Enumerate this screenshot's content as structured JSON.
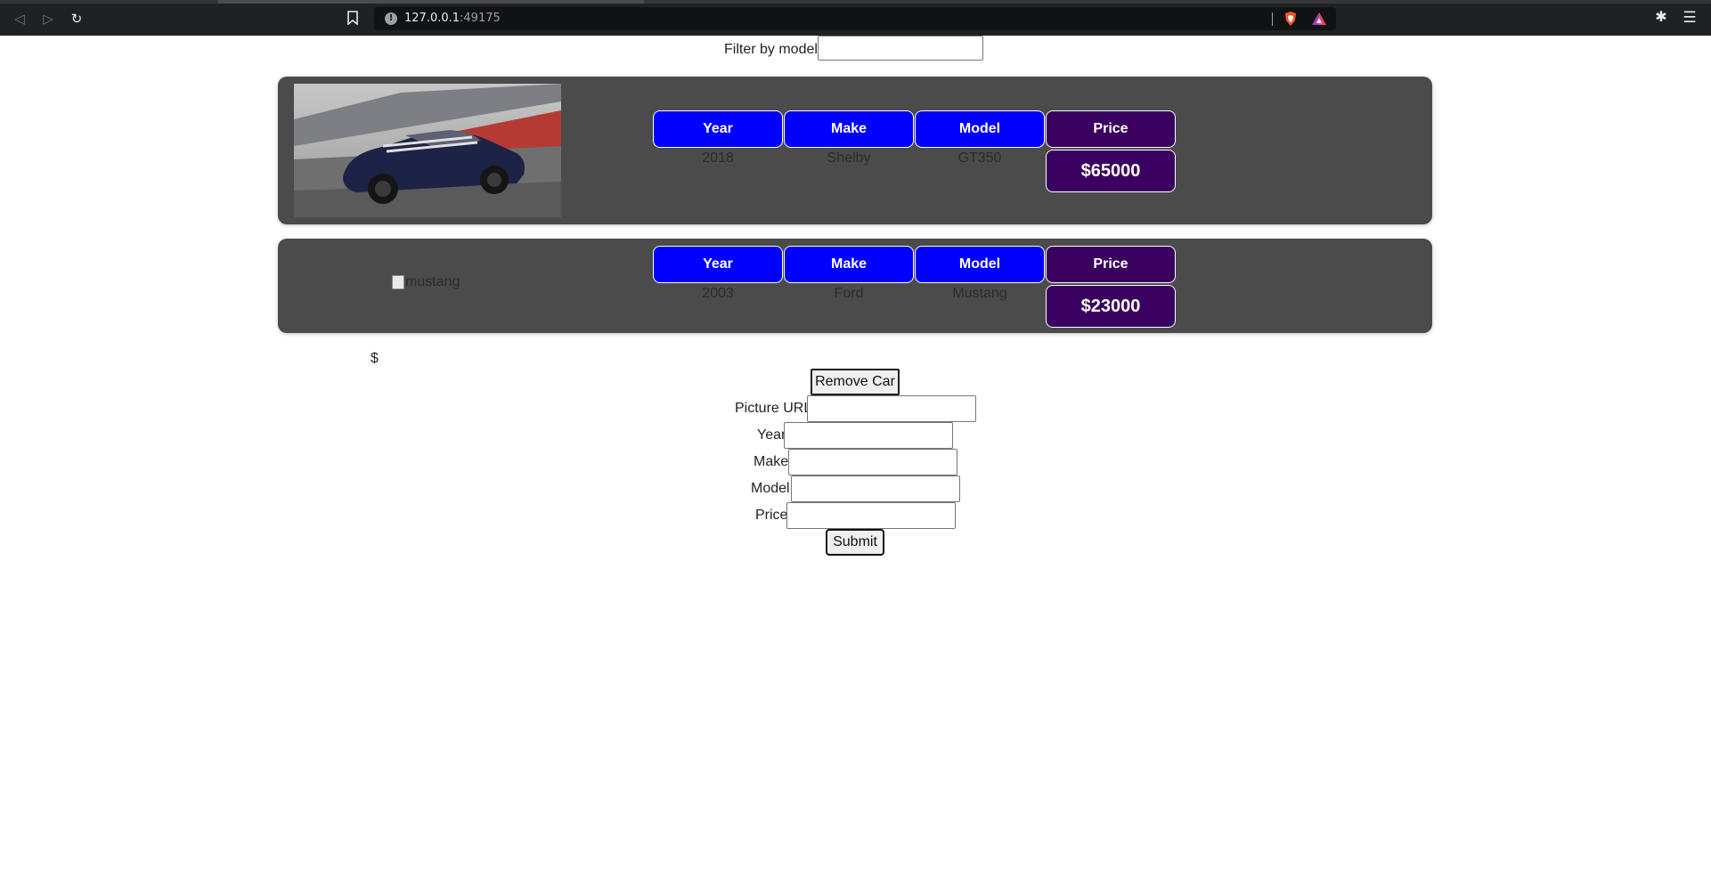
{
  "browser": {
    "url_host": "127.0.0.1",
    "url_port": ":49175",
    "icons": [
      "back-icon",
      "forward-icon",
      "reload-icon",
      "bookmark-icon",
      "site-info-icon",
      "brave-shields-icon",
      "brave-rewards-icon",
      "extensions-icon",
      "menu-icon"
    ]
  },
  "filter": {
    "label": "Filter by model",
    "value": ""
  },
  "cars": [
    {
      "image_alt": "",
      "image_icon": "car-photo",
      "headers": {
        "year": "Year",
        "make": "Make",
        "model": "Model",
        "price": "Price"
      },
      "year": "2018",
      "make": "Shelby",
      "model": "GT350",
      "price": "$65000"
    },
    {
      "image_alt": "mustang",
      "image_icon": "broken-image-icon",
      "headers": {
        "year": "Year",
        "make": "Make",
        "model": "Model",
        "price": "Price"
      },
      "year": "2003",
      "make": "Ford",
      "model": "Mustang",
      "price": "$23000"
    }
  ],
  "dollar_text": "$",
  "remove_button": "Remove Car",
  "form": {
    "picture_url_label": "Picture URL",
    "year_label": "Year",
    "make_label": "Make",
    "model_label": "Model",
    "price_label": "Price",
    "submit_label": "Submit"
  },
  "colors": {
    "header_blue": "#0000fc",
    "price_purple": "#3a0060",
    "card_bg": "#4b4b4b",
    "chrome_bg": "#202124"
  }
}
